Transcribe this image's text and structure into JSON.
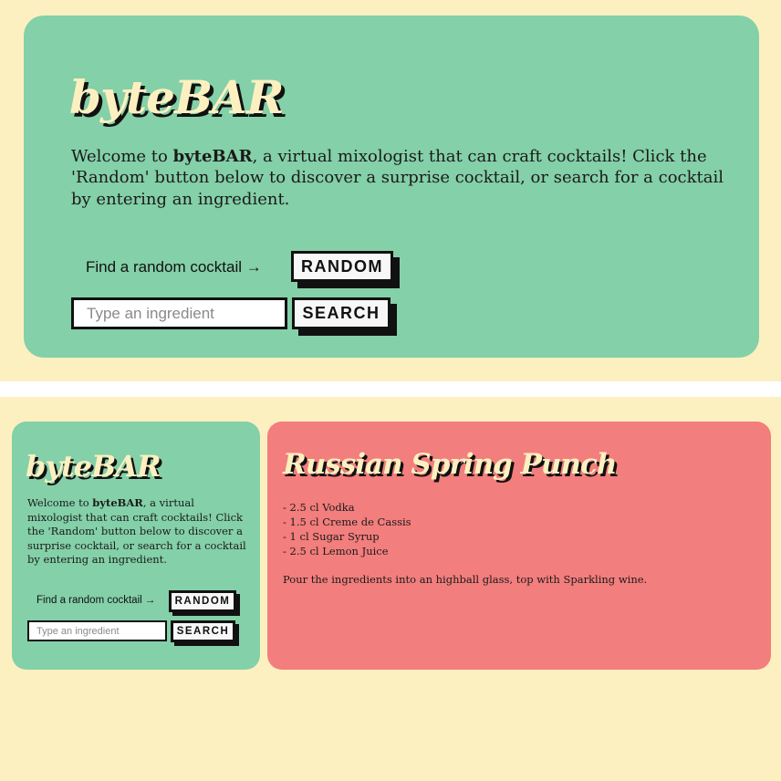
{
  "app": {
    "logo": "byteBAR",
    "intro_prefix": "Welcome to ",
    "intro_brand": "byteBAR",
    "intro_suffix": ", a virtual mixologist that can craft cocktails! Click the 'Random' button below to discover a surprise cocktail, or search for a cocktail by entering an ingredient.",
    "find_random_label": "Find a random cocktail →",
    "random_button": "RANDOM",
    "search_placeholder": "Type an ingredient",
    "search_value": "",
    "search_button": "SEARCH"
  },
  "cocktail": {
    "name": "Russian Spring Punch",
    "ingredients": [
      "- 2.5 cl Vodka",
      "- 1.5 cl Creme de Cassis",
      "- 1 cl Sugar Syrup",
      "- 2.5 cl Lemon Juice"
    ],
    "instructions": "Pour the ingredients into an highball glass, top with Sparkling wine."
  },
  "colors": {
    "background": "#fdf0c0",
    "green_card": "#84d0a8",
    "red_card": "#f27e7d",
    "logo_text": "#fdf0c0",
    "shadow": "#111111"
  }
}
